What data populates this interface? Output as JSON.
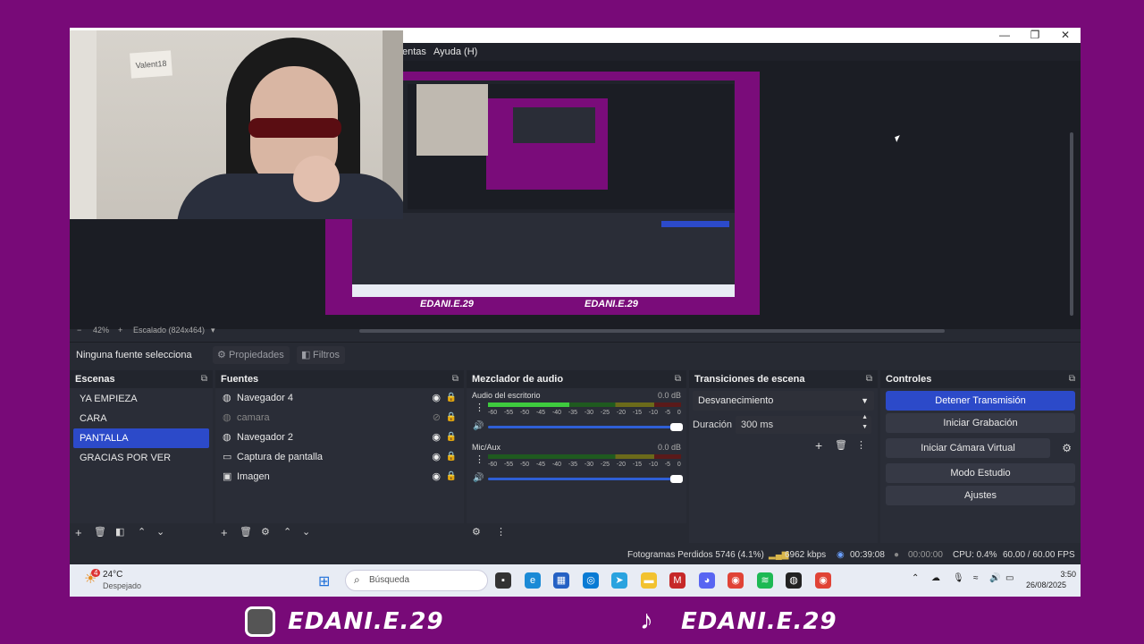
{
  "menubar": {
    "items": [
      "entas",
      "Ayuda (H)"
    ]
  },
  "window": {
    "controls": [
      "—",
      "❐",
      "✕"
    ]
  },
  "preview": {
    "zoom_minus": "−",
    "zoom_value": "42%",
    "zoom_plus": "+",
    "scale_label": "Escalado (824x464)",
    "inner_banner_left": "EDANI.E.29",
    "inner_banner_right": "EDANI.E.29"
  },
  "source_toolbar": {
    "status": "Ninguna fuente selecciona",
    "properties_label": "Propiedades",
    "filters_label": "Filtros"
  },
  "scenes": {
    "title": "Escenas",
    "items": [
      "YA EMPIEZA",
      "CARA",
      "PANTALLA",
      "GRACIAS POR VER"
    ],
    "selected_index": 2
  },
  "sources": {
    "title": "Fuentes",
    "items": [
      {
        "label": "Navegador 4",
        "icon": "globe-icon",
        "visible": true
      },
      {
        "label": "camara",
        "icon": "globe-icon",
        "visible": false
      },
      {
        "label": "Navegador 2",
        "icon": "globe-icon",
        "visible": true
      },
      {
        "label": "Captura de pantalla",
        "icon": "monitor-icon",
        "visible": true
      },
      {
        "label": "Imagen",
        "icon": "image-icon",
        "visible": true
      }
    ]
  },
  "mixer": {
    "title": "Mezclador de audio",
    "ticks": [
      "-60",
      "-55",
      "-50",
      "-45",
      "-40",
      "-35",
      "-30",
      "-25",
      "-20",
      "-15",
      "-10",
      "-5",
      "0"
    ],
    "channels": [
      {
        "name": "Audio del escritorio",
        "db": "0.0 dB",
        "level": 0.42
      },
      {
        "name": "Mic/Aux",
        "db": "0.0 dB",
        "level": 0.0
      }
    ]
  },
  "transitions": {
    "title": "Transiciones de escena",
    "selected": "Desvanecimiento",
    "duration_label": "Duración",
    "duration_value": "300 ms"
  },
  "controls": {
    "title": "Controles",
    "buttons": [
      "Detener Transmisión",
      "Iniciar Grabación",
      "Iniciar Cámara Virtual",
      "Modo Estudio",
      "Ajustes"
    ]
  },
  "status": {
    "dropped": "Fotogramas Perdidos 5746 (4.1%)",
    "bitrate": "6962 kbps",
    "stream_time": "00:39:08",
    "rec_time": "00:00:00",
    "cpu": "CPU: 0.4%",
    "fps": "60.00 / 60.00 FPS"
  },
  "taskbar": {
    "weather_temp": "24°C",
    "weather_desc": "Despejado",
    "weather_badge": "4",
    "search_placeholder": "Búsqueda",
    "time": "3:50",
    "date": "26/08/2025"
  },
  "banner": {
    "left": "EDANI.E.29",
    "right": "EDANI.E.29"
  },
  "webcam": {
    "sign_text": "Valent18"
  },
  "colors": {
    "background": "#780a78",
    "accent": "#2c4ac9"
  }
}
